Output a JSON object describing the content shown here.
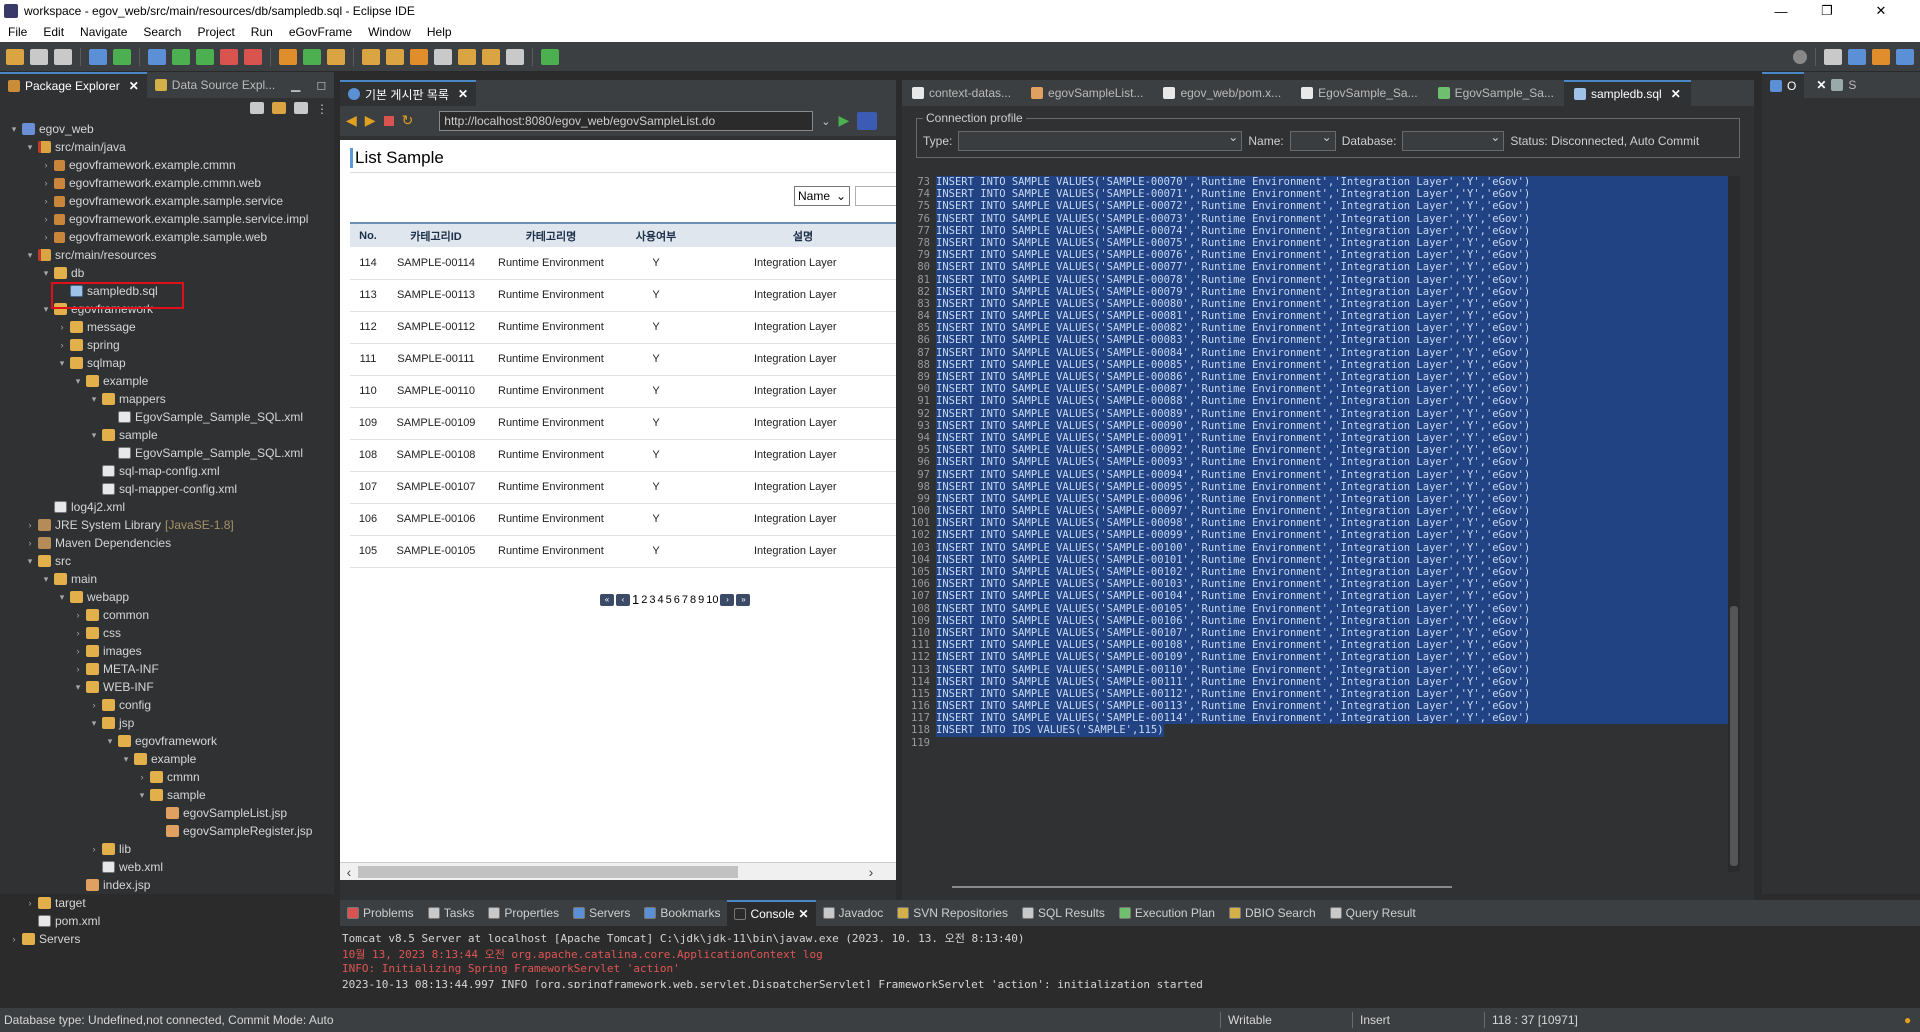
{
  "window": {
    "title": "workspace - egov_web/src/main/resources/db/sampledb.sql - Eclipse IDE",
    "controls": [
      "—",
      "❐",
      "✕"
    ]
  },
  "menu": [
    "File",
    "Edit",
    "Navigate",
    "Search",
    "Project",
    "Run",
    "eGovFrame",
    "Window",
    "Help"
  ],
  "explorer": {
    "tabs": [
      {
        "label": "Package Explorer",
        "close": "✕"
      },
      {
        "label": "Data Source Expl..."
      }
    ],
    "tree": [
      {
        "label": "egov_web",
        "indent": 0,
        "icon": "proj",
        "arrow": "▾"
      },
      {
        "label": "src/main/java",
        "indent": 1,
        "icon": "srcfolder",
        "arrow": "▾"
      },
      {
        "label": "egovframework.example.cmmn",
        "indent": 2,
        "icon": "pkg",
        "arrow": "›"
      },
      {
        "label": "egovframework.example.cmmn.web",
        "indent": 2,
        "icon": "pkg",
        "arrow": "›"
      },
      {
        "label": "egovframework.example.sample.service",
        "indent": 2,
        "icon": "pkg",
        "arrow": "›"
      },
      {
        "label": "egovframework.example.sample.service.impl",
        "indent": 2,
        "icon": "pkg",
        "arrow": "›"
      },
      {
        "label": "egovframework.example.sample.web",
        "indent": 2,
        "icon": "pkg",
        "arrow": "›"
      },
      {
        "label": "src/main/resources",
        "indent": 1,
        "icon": "srcfolder",
        "arrow": "▾"
      },
      {
        "label": "db",
        "indent": 2,
        "icon": "folder",
        "arrow": "▾"
      },
      {
        "label": "sampledb.sql",
        "indent": 3,
        "icon": "sql",
        "arrow": ""
      },
      {
        "label": "egovframework",
        "indent": 2,
        "icon": "folder",
        "arrow": "▾"
      },
      {
        "label": "message",
        "indent": 3,
        "icon": "folder",
        "arrow": "›"
      },
      {
        "label": "spring",
        "indent": 3,
        "icon": "folder",
        "arrow": "›"
      },
      {
        "label": "sqlmap",
        "indent": 3,
        "icon": "folder",
        "arrow": "▾"
      },
      {
        "label": "example",
        "indent": 4,
        "icon": "folder",
        "arrow": "▾"
      },
      {
        "label": "mappers",
        "indent": 5,
        "icon": "folder",
        "arrow": "▾"
      },
      {
        "label": "EgovSample_Sample_SQL.xml",
        "indent": 6,
        "icon": "xml",
        "arrow": ""
      },
      {
        "label": "sample",
        "indent": 5,
        "icon": "folder",
        "arrow": "▾"
      },
      {
        "label": "EgovSample_Sample_SQL.xml",
        "indent": 6,
        "icon": "xml",
        "arrow": ""
      },
      {
        "label": "sql-map-config.xml",
        "indent": 5,
        "icon": "xml",
        "arrow": ""
      },
      {
        "label": "sql-mapper-config.xml",
        "indent": 5,
        "icon": "xml",
        "arrow": ""
      },
      {
        "label": "log4j2.xml",
        "indent": 2,
        "icon": "xml",
        "arrow": ""
      },
      {
        "label": "JRE System Library",
        "indent": 1,
        "icon": "lib",
        "arrow": "›",
        "tag": "[JavaSE-1.8]"
      },
      {
        "label": "Maven Dependencies",
        "indent": 1,
        "icon": "lib",
        "arrow": "›"
      },
      {
        "label": "src",
        "indent": 1,
        "icon": "folder",
        "arrow": "▾"
      },
      {
        "label": "main",
        "indent": 2,
        "icon": "folder",
        "arrow": "▾"
      },
      {
        "label": "webapp",
        "indent": 3,
        "icon": "folder",
        "arrow": "▾"
      },
      {
        "label": "common",
        "indent": 4,
        "icon": "folder",
        "arrow": "›"
      },
      {
        "label": "css",
        "indent": 4,
        "icon": "folder",
        "arrow": "›"
      },
      {
        "label": "images",
        "indent": 4,
        "icon": "folder",
        "arrow": "›"
      },
      {
        "label": "META-INF",
        "indent": 4,
        "icon": "folder",
        "arrow": "›"
      },
      {
        "label": "WEB-INF",
        "indent": 4,
        "icon": "folder",
        "arrow": "▾"
      },
      {
        "label": "config",
        "indent": 5,
        "icon": "folder",
        "arrow": "›"
      },
      {
        "label": "jsp",
        "indent": 5,
        "icon": "folder",
        "arrow": "▾"
      },
      {
        "label": "egovframework",
        "indent": 6,
        "icon": "folder",
        "arrow": "▾"
      },
      {
        "label": "example",
        "indent": 7,
        "icon": "folder",
        "arrow": "▾"
      },
      {
        "label": "cmmn",
        "indent": 8,
        "icon": "folder",
        "arrow": "›"
      },
      {
        "label": "sample",
        "indent": 8,
        "icon": "folder",
        "arrow": "▾"
      },
      {
        "label": "egovSampleList.jsp",
        "indent": 9,
        "icon": "jsp",
        "arrow": ""
      },
      {
        "label": "egovSampleRegister.jsp",
        "indent": 9,
        "icon": "jsp",
        "arrow": ""
      },
      {
        "label": "lib",
        "indent": 5,
        "icon": "folder",
        "arrow": "›"
      },
      {
        "label": "web.xml",
        "indent": 5,
        "icon": "xml",
        "arrow": ""
      },
      {
        "label": "index.jsp",
        "indent": 4,
        "icon": "jsp",
        "arrow": ""
      },
      {
        "label": "target",
        "indent": 1,
        "icon": "folder",
        "arrow": "›"
      },
      {
        "label": "pom.xml",
        "indent": 1,
        "icon": "xml",
        "arrow": ""
      },
      {
        "label": "Servers",
        "indent": 0,
        "icon": "folder",
        "arrow": "›"
      }
    ]
  },
  "browser": {
    "tab": "기본 게시판 목록",
    "close": "✕",
    "url": "http://localhost:8080/egov_web/egovSampleList.do",
    "page_title": "List Sample",
    "search_select": "Name",
    "columns": [
      "No.",
      "카테고리ID",
      "카테고리명",
      "사용여부",
      "설명"
    ],
    "rows": [
      [
        "114",
        "SAMPLE-00114",
        "Runtime Environment",
        "Y",
        "Integration Layer"
      ],
      [
        "113",
        "SAMPLE-00113",
        "Runtime Environment",
        "Y",
        "Integration Layer"
      ],
      [
        "112",
        "SAMPLE-00112",
        "Runtime Environment",
        "Y",
        "Integration Layer"
      ],
      [
        "111",
        "SAMPLE-00111",
        "Runtime Environment",
        "Y",
        "Integration Layer"
      ],
      [
        "110",
        "SAMPLE-00110",
        "Runtime Environment",
        "Y",
        "Integration Layer"
      ],
      [
        "109",
        "SAMPLE-00109",
        "Runtime Environment",
        "Y",
        "Integration Layer"
      ],
      [
        "108",
        "SAMPLE-00108",
        "Runtime Environment",
        "Y",
        "Integration Layer"
      ],
      [
        "107",
        "SAMPLE-00107",
        "Runtime Environment",
        "Y",
        "Integration Layer"
      ],
      [
        "106",
        "SAMPLE-00106",
        "Runtime Environment",
        "Y",
        "Integration Layer"
      ],
      [
        "105",
        "SAMPLE-00105",
        "Runtime Environment",
        "Y",
        "Integration Layer"
      ]
    ],
    "pages": [
      "1",
      "2",
      "3",
      "4",
      "5",
      "6",
      "7",
      "8",
      "9",
      "10"
    ]
  },
  "editor": {
    "tabs": [
      "context-datas...",
      "egovSampleList...",
      "egov_web/pom.x...",
      "EgovSample_Sa...",
      "EgovSample_Sa...",
      "sampledb.sql"
    ],
    "active_tab": 5,
    "close": "✕",
    "connection": {
      "group_label": "Connection profile",
      "type_label": "Type:",
      "name_label": "Name:",
      "database_label": "Database:",
      "status": "Status:  Disconnected, Auto Commit"
    },
    "first_line": 73,
    "first_sample": 70,
    "last_line": 119,
    "statement_prefix": "INSERT INTO SAMPLE VALUES('SAMPLE-00",
    "statement_suffix": "','Runtime Environment','Integration Layer','Y','eGov')",
    "ids_statement": "INSERT INTO IDS VALUES('SAMPLE',115)"
  },
  "outline": {
    "tab": "O",
    "tab2": "S"
  },
  "console": {
    "tabs": [
      "Problems",
      "Tasks",
      "Properties",
      "Servers",
      "Bookmarks",
      "Console",
      "Javadoc",
      "SVN Repositories",
      "SQL Results",
      "Execution Plan",
      "DBIO Search",
      "Query Result"
    ],
    "active_tab": "Console",
    "server_line": "Tomcat v8.5 Server at localhost [Apache Tomcat] C:\\jdk\\jdk-11\\bin\\javaw.exe  (2023. 10. 13. 오전 8:13:40)",
    "lines": [
      "10월 13, 2023 8:13:44 오전 org.apache.catalina.core.ApplicationContext log",
      "INFO: Initializing Spring FrameworkServlet 'action'",
      "2023-10-13 08:13:44,997  INFO [org.springframework.web.servlet.DispatcherServlet] FrameworkServlet 'action': initialization started"
    ]
  },
  "status": {
    "db": "Database type: Undefined,not connected, Commit Mode: Auto",
    "writable": "Writable",
    "insert": "Insert",
    "position": "118 : 37 [10971]"
  }
}
